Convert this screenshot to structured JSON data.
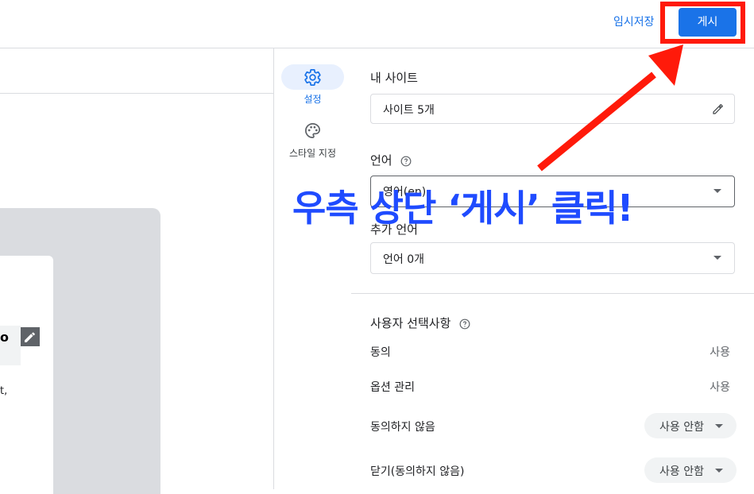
{
  "topbar": {
    "draft_label": "임시저장",
    "publish_label": "게시"
  },
  "preview": {
    "card_title_fragment": "o",
    "card_text_fragment": "t,"
  },
  "rail": {
    "items": [
      {
        "label": "설정",
        "icon": "gear-icon",
        "active": true
      },
      {
        "label": "스타일 지정",
        "icon": "palette-icon",
        "active": false
      }
    ]
  },
  "panel": {
    "my_sites": {
      "title": "내 사이트",
      "value": "사이트 5개"
    },
    "language": {
      "title": "언어",
      "value": "영어(en)"
    },
    "extra_language": {
      "title": "추가 언어",
      "value": "언어 0개"
    },
    "user_choices": {
      "title": "사용자 선택사항",
      "rows": [
        {
          "label": "동의",
          "value": "사용"
        },
        {
          "label": "옵션 관리",
          "value": "사용"
        },
        {
          "label": "동의하지 않음",
          "value": "사용 안함"
        },
        {
          "label": "닫기(동의하지 않음)",
          "value": "사용 안함"
        }
      ]
    }
  },
  "annotation": {
    "text": "우측 상단 ‘게시’ 클릭!"
  },
  "colors": {
    "accent": "#1a73e8",
    "highlight": "#ff1a0a",
    "annotation": "#1f4bff"
  }
}
